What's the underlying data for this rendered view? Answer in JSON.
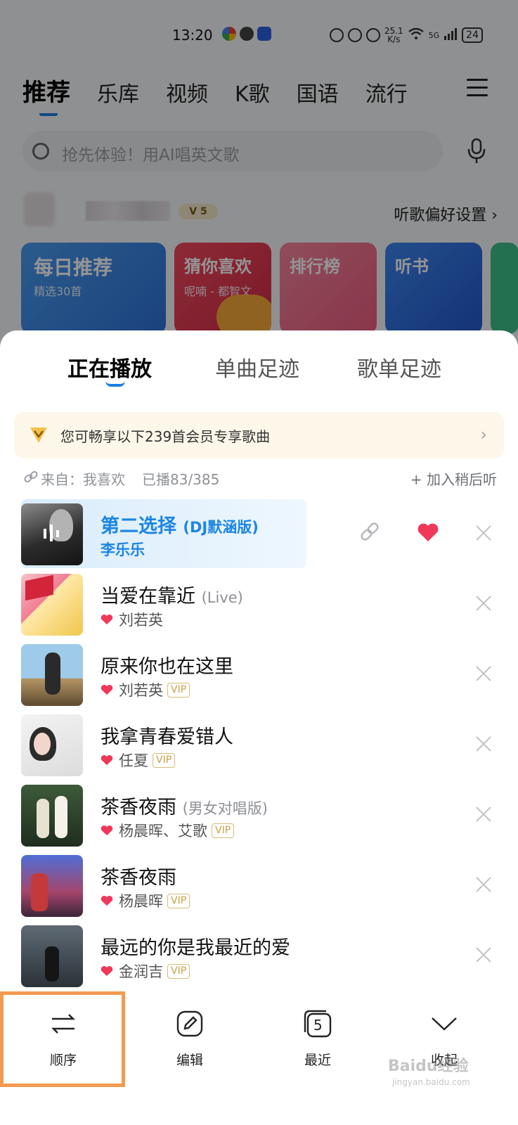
{
  "status_bar": {
    "time": "13:20",
    "net_speed_value": "25.1",
    "net_speed_unit": "K/s",
    "signal": "5G",
    "battery": "24"
  },
  "top_nav": {
    "tabs": [
      "推荐",
      "乐库",
      "视频",
      "K歌",
      "国语",
      "流行"
    ],
    "active_index": 0
  },
  "search": {
    "placeholder": "抢先体验！用AI唱英文歌"
  },
  "user_row": {
    "vip_level": "5",
    "pref_link": "听歌偏好设置"
  },
  "cards": [
    {
      "title": "每日推荐",
      "subtitle": "精选30首",
      "color": "#3e8de8"
    },
    {
      "title": "猜你喜欢",
      "subtitle": "呢喃 - 都智文",
      "color": "#ea3f55"
    },
    {
      "title": "排行榜",
      "subtitle": "",
      "color": "#f06f8c"
    },
    {
      "title": "听书",
      "subtitle": "",
      "color": "#2f6fe0"
    }
  ],
  "sheet": {
    "tabs": [
      "正在播放",
      "单曲足迹",
      "歌单足迹"
    ],
    "active_tab": 0,
    "vip_banner": "您可畅享以下239首会员专享歌曲",
    "source_label": "来自：我喜欢",
    "played": "已播83/385",
    "add_later": "+ 加入稍后听"
  },
  "songs": [
    {
      "title": "第二选择",
      "subtitle": "(DJ默涵版)",
      "artist": "李乐乐",
      "liked": false,
      "vip": false,
      "playing": true
    },
    {
      "title": "当爱在靠近",
      "subtitle": "(Live)",
      "artist": "刘若英",
      "liked": true,
      "vip": false,
      "playing": false
    },
    {
      "title": "原来你也在这里",
      "subtitle": "",
      "artist": "刘若英",
      "liked": true,
      "vip": true,
      "playing": false
    },
    {
      "title": "我拿青春爱错人",
      "subtitle": "",
      "artist": "任夏",
      "liked": true,
      "vip": true,
      "playing": false
    },
    {
      "title": "茶香夜雨",
      "subtitle": "(男女对唱版)",
      "artist": "杨晨晖、艾歌",
      "liked": true,
      "vip": true,
      "playing": false
    },
    {
      "title": "茶香夜雨",
      "subtitle": "",
      "artist": "杨晨晖",
      "liked": true,
      "vip": true,
      "playing": false
    },
    {
      "title": "最远的你是我最近的爱",
      "subtitle": "",
      "artist": "金润吉",
      "liked": true,
      "vip": true,
      "playing": false
    }
  ],
  "vip_tag_label": "VIP",
  "toolbar": {
    "order_label": "顺序",
    "edit_label": "编辑",
    "recent_label": "最近",
    "recent_count": "5",
    "collapse_label": "收起"
  },
  "watermark": {
    "text": "Baidu经验",
    "url": "jingyan.baidu.com"
  },
  "colors": {
    "accent": "#1d86e3",
    "heart": "#f0385a",
    "highlight_box": "#f49a50"
  }
}
